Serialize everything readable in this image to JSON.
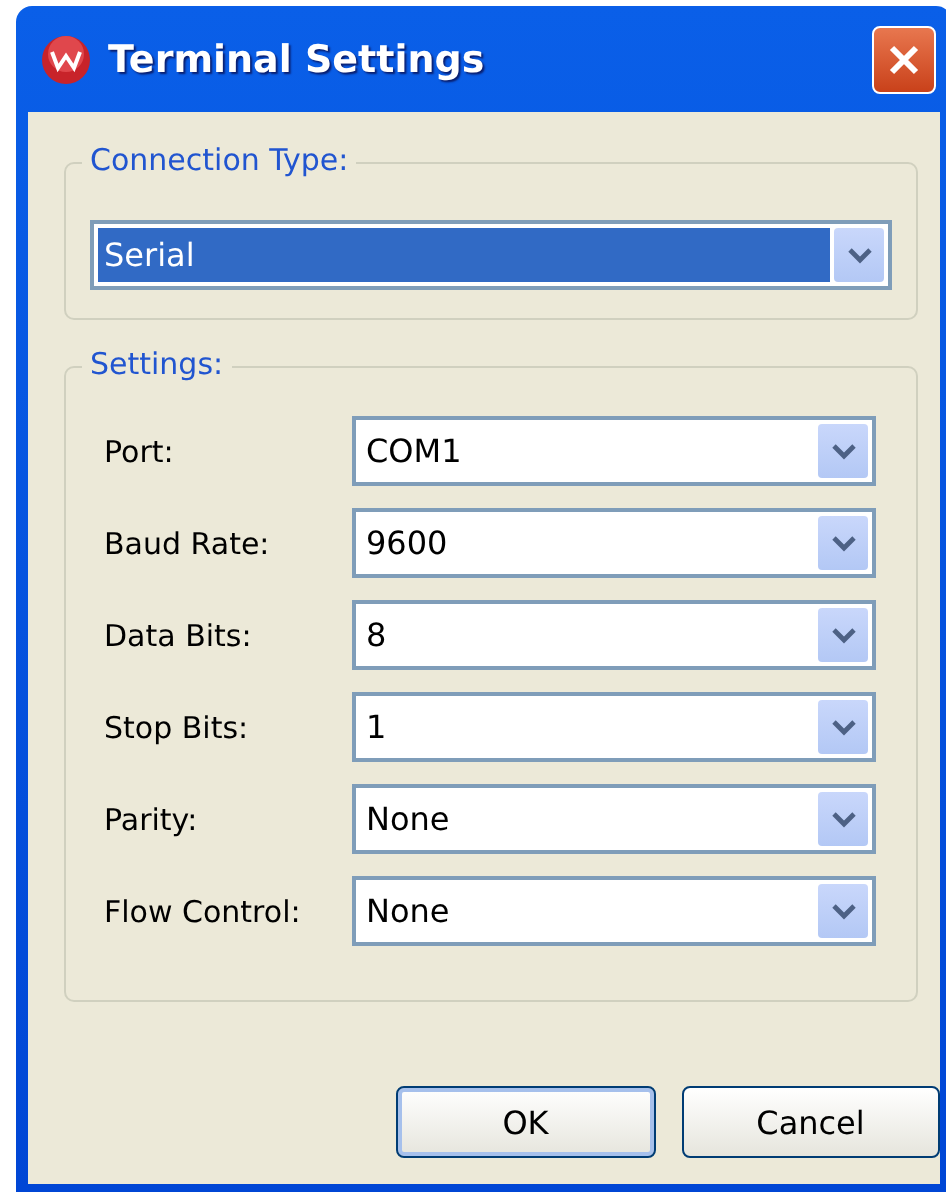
{
  "window": {
    "title": "Terminal Settings"
  },
  "connection": {
    "legend": "Connection Type:",
    "value": "Serial",
    "highlighted": true
  },
  "settings": {
    "legend": "Settings:",
    "rows": [
      {
        "label": "Port:",
        "value": "COM1"
      },
      {
        "label": "Baud Rate:",
        "value": "9600"
      },
      {
        "label": "Data Bits:",
        "value": "8"
      },
      {
        "label": "Stop Bits:",
        "value": "1"
      },
      {
        "label": "Parity:",
        "value": "None"
      },
      {
        "label": "Flow Control:",
        "value": "None"
      }
    ]
  },
  "buttons": [
    {
      "label": "OK",
      "default": true
    },
    {
      "label": "Cancel",
      "default": false
    }
  ]
}
